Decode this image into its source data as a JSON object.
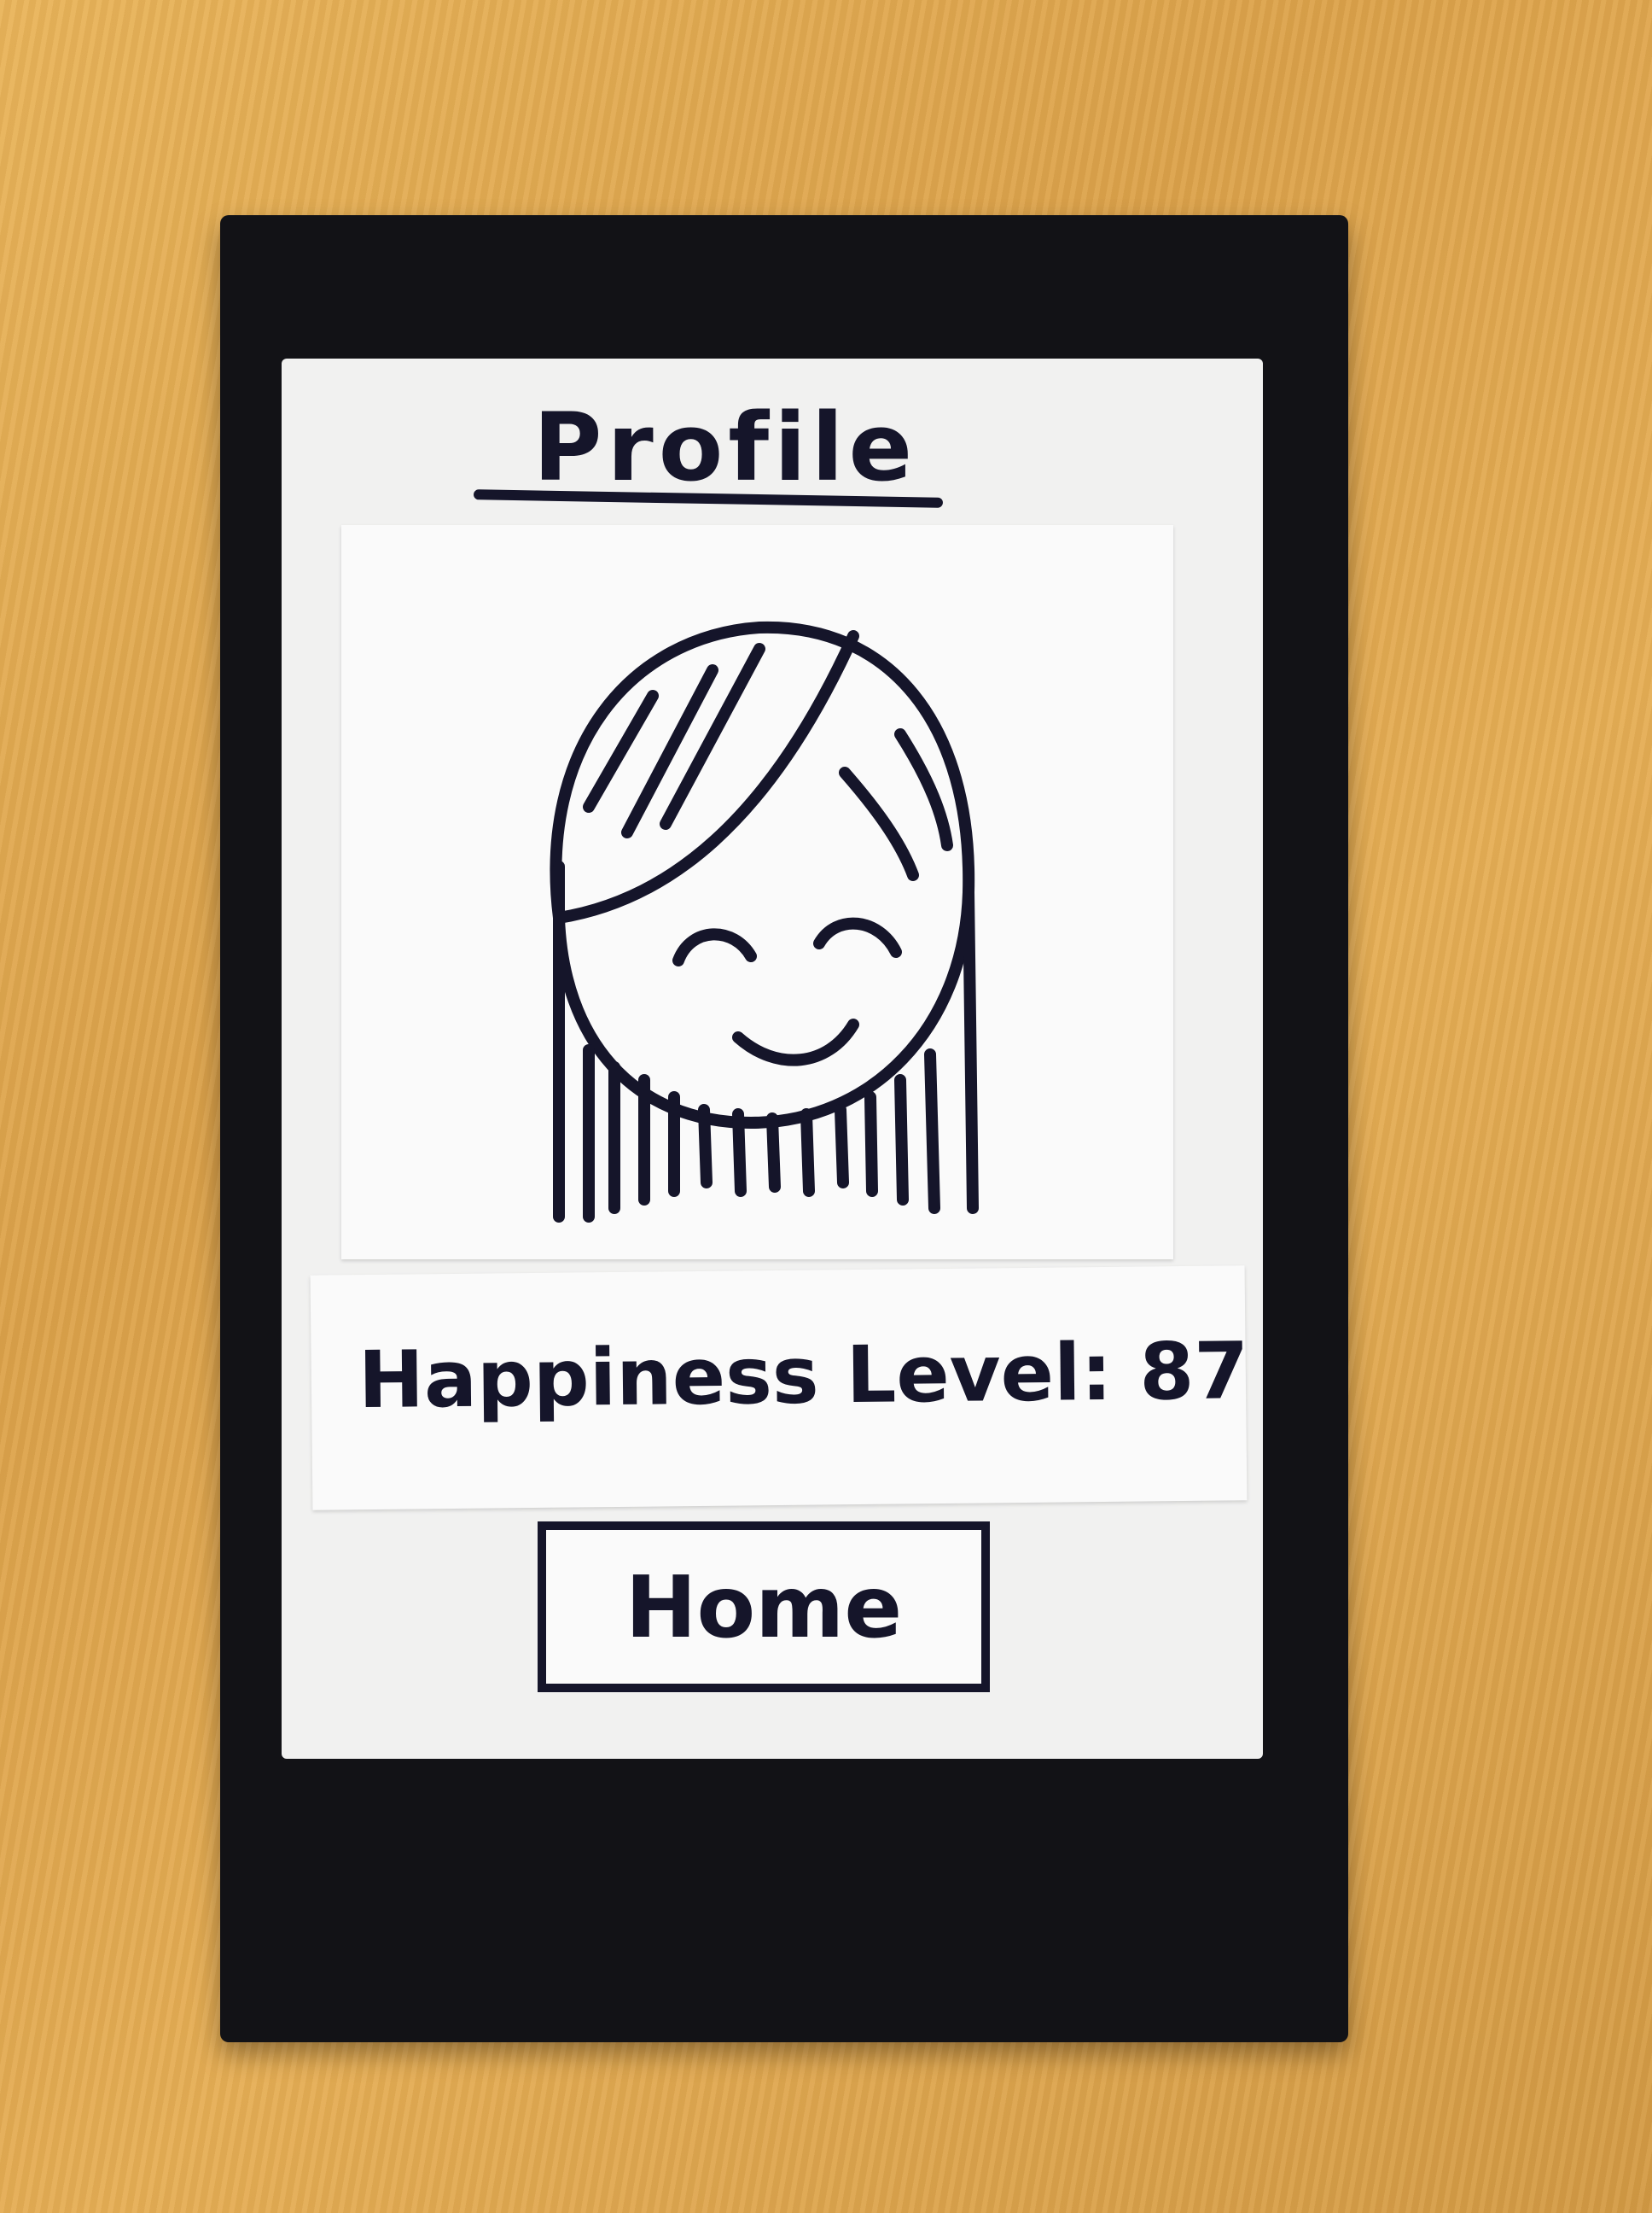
{
  "screen": {
    "title": "Profile",
    "happiness": {
      "label": "Happiness Level:",
      "value": "87"
    },
    "home_button_label": "Home"
  },
  "colors": {
    "ink": "#15152a",
    "paper": "#f1f1f0",
    "frame": "#121216",
    "desk": "#e0a84f"
  },
  "icons": {
    "avatar": "smiling-girl-avatar-icon"
  }
}
